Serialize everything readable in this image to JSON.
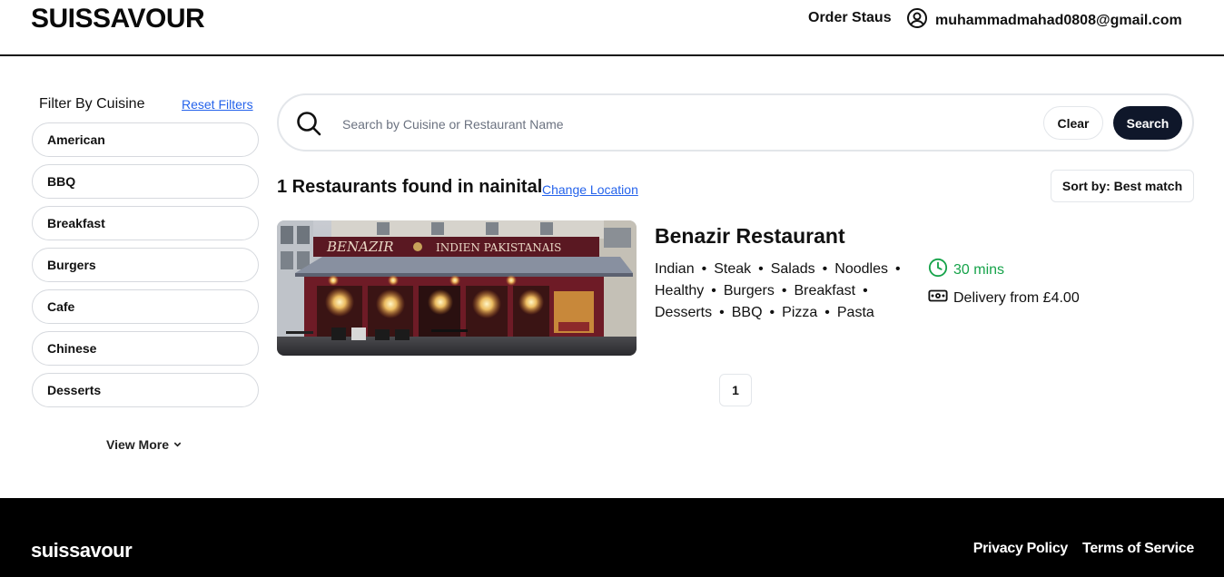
{
  "header": {
    "brand": "SUISSAVOUR",
    "order_status": "Order Staus",
    "user_email": "muhammadmahad0808@gmail.com"
  },
  "sidebar": {
    "title": "Filter By Cuisine",
    "reset_label": "Reset Filters",
    "cuisines": [
      "American",
      "BBQ",
      "Breakfast",
      "Burgers",
      "Cafe",
      "Chinese",
      "Desserts"
    ],
    "view_more": "View More"
  },
  "search": {
    "placeholder": "Search by Cuisine or Restaurant Name",
    "value": "",
    "clear_label": "Clear",
    "search_label": "Search"
  },
  "results": {
    "count_text": "1 Restaurants found in nainital",
    "change_location": "Change Location",
    "sort_label": "Sort by: Best match"
  },
  "restaurant": {
    "name": "Benazir Restaurant",
    "sign_main": "BENAZIR",
    "sign_sub": "INDIEN  PAKISTANAIS",
    "cuisines": [
      "Indian",
      "Steak",
      "Salads",
      "Noodles",
      "Healthy",
      "Burgers",
      "Breakfast",
      "Desserts",
      "BBQ",
      "Pizza",
      "Pasta"
    ],
    "delivery_time": "30 mins",
    "delivery_fee": "Delivery from £4.00"
  },
  "pagination": {
    "current_page": "1"
  },
  "footer": {
    "brand": "suissavour",
    "privacy": "Privacy Policy",
    "terms": "Terms of Service"
  },
  "colors": {
    "accent_dark": "#0f172a",
    "link_blue": "#2563eb",
    "time_green": "#16a34a"
  }
}
